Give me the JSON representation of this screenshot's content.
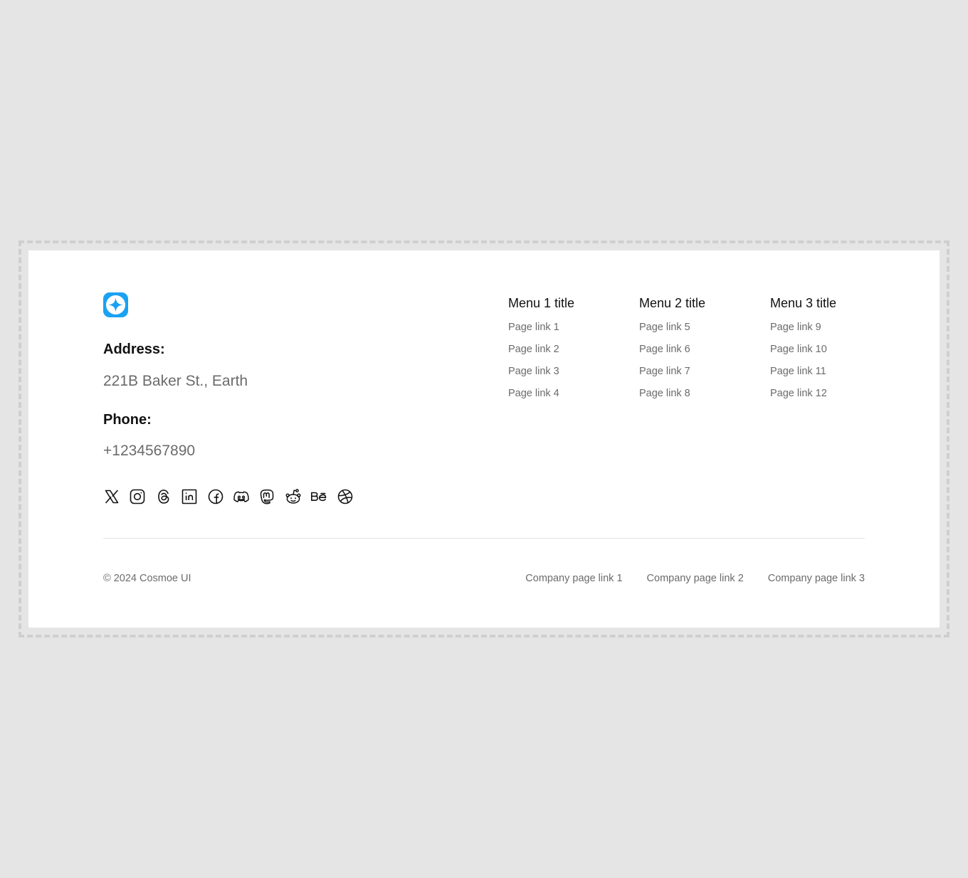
{
  "brand": {
    "logo_icon": "sparkle-logo-icon",
    "logo_color": "#1ba1f2"
  },
  "contact": {
    "address_label": "Address:",
    "address_value": "221B Baker St., Earth",
    "phone_label": "Phone:",
    "phone_value": "+1234567890"
  },
  "socials": [
    {
      "icon": "x-icon"
    },
    {
      "icon": "instagram-icon"
    },
    {
      "icon": "threads-icon"
    },
    {
      "icon": "linkedin-icon"
    },
    {
      "icon": "facebook-icon"
    },
    {
      "icon": "discord-icon"
    },
    {
      "icon": "mastodon-icon"
    },
    {
      "icon": "reddit-icon"
    },
    {
      "icon": "behance-icon"
    },
    {
      "icon": "dribbble-icon"
    }
  ],
  "menus": [
    {
      "title": "Menu 1 title",
      "links": [
        "Page link 1",
        "Page link 2",
        "Page link 3",
        "Page link 4"
      ]
    },
    {
      "title": "Menu 2 title",
      "links": [
        "Page link 5",
        "Page link 6",
        "Page link 7",
        "Page link 8"
      ]
    },
    {
      "title": "Menu 3 title",
      "links": [
        "Page link 9",
        "Page link 10",
        "Page link 11",
        "Page link 12"
      ]
    }
  ],
  "bottom": {
    "copyright": "© 2024 Cosmoe UI",
    "company_links": [
      "Company page link 1",
      "Company page link 2",
      "Company page link 3"
    ]
  },
  "colors": {
    "page_background": "#e5e5e5",
    "footer_background": "#ffffff",
    "muted_text": "#6b6b6b",
    "heading_text": "#111111"
  }
}
